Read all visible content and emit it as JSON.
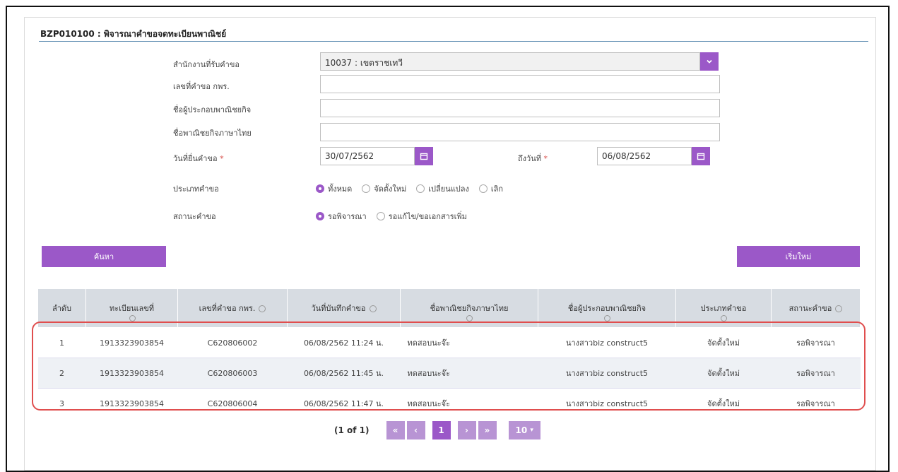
{
  "page_title": "BZP010100 : พิจารณาคำขอจดทะเบียนพาณิชย์",
  "form": {
    "office_label": "สำนักงานที่รับคำขอ",
    "office_value": "10037 : เขตราชเทวี",
    "req_no_label": "เลขที่คำขอ กพร.",
    "operator_name_label": "ชื่อผู้ประกอบพาณิชยกิจ",
    "business_name_label": "ชื่อพาณิชยกิจภาษาไทย",
    "date_from_label": "วันที่ยื่นคำขอ",
    "date_from_value": "30/07/2562",
    "date_to_label": "ถึงวันที่",
    "date_to_value": "06/08/2562",
    "required_mark": "*",
    "request_type_label": "ประเภทคำขอ",
    "request_type_options": [
      "ทั้งหมด",
      "จัดตั้งใหม่",
      "เปลี่ยนแปลง",
      "เลิก"
    ],
    "status_label": "สถานะคำขอ",
    "status_options": [
      "รอพิจารณา",
      "รอแก้ไข/ขอเอกสารเพิ่ม"
    ]
  },
  "buttons": {
    "search": "ค้นหา",
    "reset": "เริ่มใหม่"
  },
  "table": {
    "columns": [
      "ลำดับ",
      "ทะเบียนเลขที่",
      "เลขที่คำขอ กพร.",
      "วันที่บันทึกคำขอ",
      "ชื่อพาณิชยกิจภาษาไทย",
      "ชื่อผู้ประกอบพาณิชยกิจ",
      "ประเภทคำขอ",
      "สถานะคำขอ"
    ],
    "rows": [
      [
        "1",
        "1913323903854",
        "C620806002",
        "06/08/2562 11:24 น.",
        "ทดสอบนะจ๊ะ",
        "นางสาวbiz construct5",
        "จัดตั้งใหม่",
        "รอพิจารณา"
      ],
      [
        "2",
        "1913323903854",
        "C620806003",
        "06/08/2562 11:45 น.",
        "ทดสอบนะจ๊ะ",
        "นางสาวbiz construct5",
        "จัดตั้งใหม่",
        "รอพิจารณา"
      ],
      [
        "3",
        "1913323903854",
        "C620806004",
        "06/08/2562 11:47 น.",
        "ทดสอบนะจ๊ะ",
        "นางสาวbiz construct5",
        "จัดตั้งใหม่",
        "รอพิจารณา"
      ]
    ]
  },
  "pager": {
    "info": "(1 of 1)",
    "first": "«",
    "prev": "‹",
    "current": "1",
    "next": "›",
    "last": "»",
    "page_size": "10",
    "page_size_caret": "▾"
  },
  "colors": {
    "accent": "#9b58c8",
    "highlight": "#e04e4e"
  }
}
